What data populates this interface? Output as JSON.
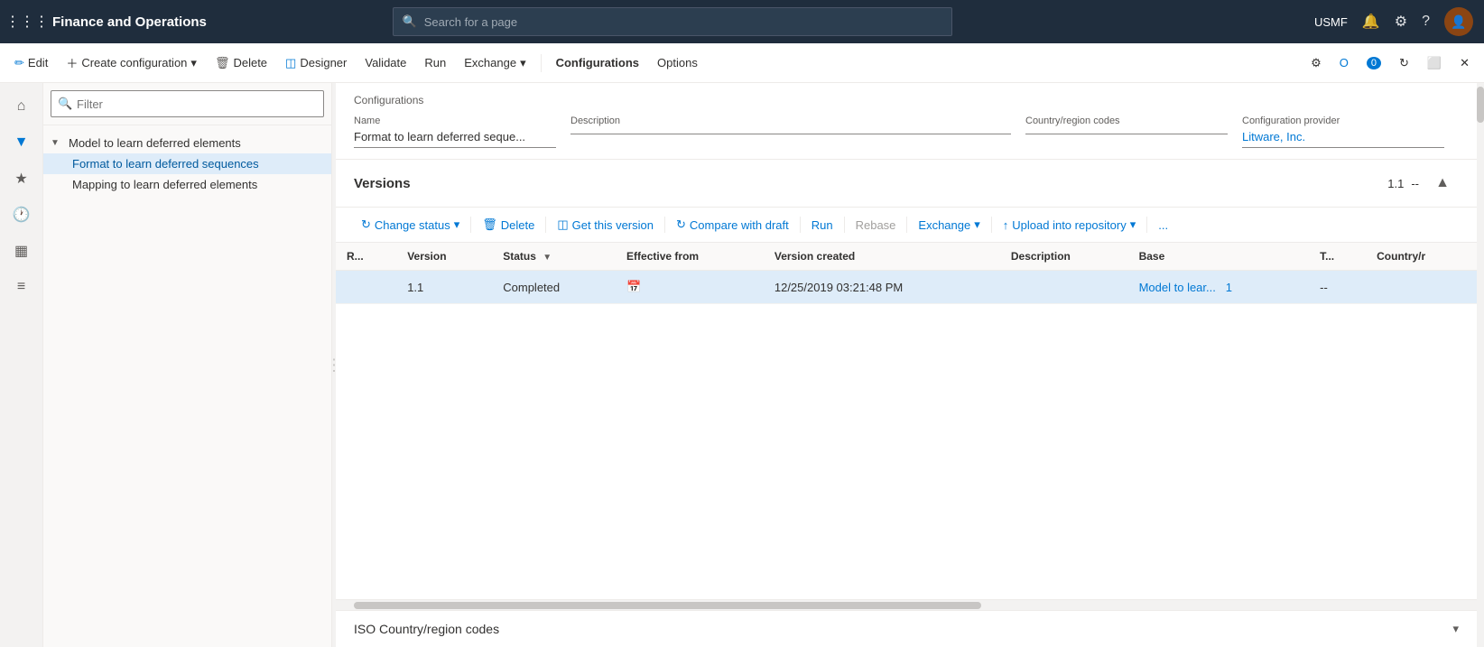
{
  "app": {
    "title": "Finance and Operations"
  },
  "topbar": {
    "search_placeholder": "Search for a page",
    "user": "USMF"
  },
  "commandbar": {
    "edit": "Edit",
    "create_config": "Create configuration",
    "delete": "Delete",
    "designer": "Designer",
    "validate": "Validate",
    "run": "Run",
    "exchange": "Exchange",
    "configurations": "Configurations",
    "options": "Options"
  },
  "sidebar": {
    "items": [
      {
        "label": "Home",
        "icon": "⌂"
      },
      {
        "label": "Filter",
        "icon": "▼"
      },
      {
        "label": "Favorites",
        "icon": "★"
      },
      {
        "label": "Recent",
        "icon": "🕐"
      },
      {
        "label": "Workspaces",
        "icon": "▦"
      },
      {
        "label": "List",
        "icon": "≡"
      }
    ]
  },
  "tree": {
    "filter_placeholder": "Filter",
    "items": [
      {
        "label": "Model to learn deferred elements",
        "type": "parent",
        "expanded": true
      },
      {
        "label": "Format to learn deferred sequences",
        "type": "child",
        "selected": true
      },
      {
        "label": "Mapping to learn deferred elements",
        "type": "child",
        "selected": false
      }
    ]
  },
  "config_header": {
    "section_title": "Configurations",
    "fields": {
      "name_label": "Name",
      "name_value": "Format to learn deferred seque...",
      "description_label": "Description",
      "description_value": "",
      "country_label": "Country/region codes",
      "country_value": "",
      "provider_label": "Configuration provider",
      "provider_value": "Litware, Inc."
    }
  },
  "versions": {
    "title": "Versions",
    "meta_version": "1.1",
    "meta_separator": "--",
    "toolbar": {
      "change_status": "Change status",
      "delete": "Delete",
      "get_this_version": "Get this version",
      "compare_with_draft": "Compare with draft",
      "run": "Run",
      "rebase": "Rebase",
      "exchange": "Exchange",
      "upload_into_repository": "Upload into repository",
      "more": "..."
    },
    "table": {
      "columns": [
        "R...",
        "Version",
        "Status",
        "Effective from",
        "Version created",
        "Description",
        "Base",
        "T...",
        "Country/r"
      ],
      "rows": [
        {
          "r": "",
          "version": "1.1",
          "status": "Completed",
          "effective_from": "",
          "version_created": "12/25/2019 03:21:48 PM",
          "description": "",
          "base": "Model to lear...",
          "base_link": "1",
          "t": "--",
          "country": ""
        }
      ]
    }
  },
  "iso_section": {
    "title": "ISO Country/region codes"
  }
}
